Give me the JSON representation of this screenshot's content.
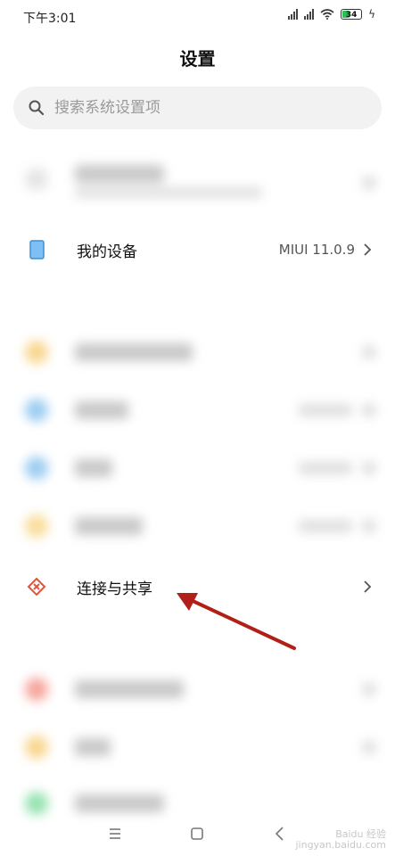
{
  "status_bar": {
    "time": "下午3:01",
    "battery": "34"
  },
  "page": {
    "title": "设置"
  },
  "search": {
    "placeholder": "搜索系统设置项"
  },
  "my_device": {
    "label": "我的设备",
    "value": "MIUI 11.0.9"
  },
  "connection_sharing": {
    "label": "连接与共享"
  },
  "colors": {
    "device_icon": "#5ba8ea",
    "share_icon": "#e2533d",
    "arrow": "#b21f18",
    "blur_orange": "#f5b432",
    "blur_blue": "#4aa3e6",
    "blur_red": "#ef5a4b",
    "blur_green": "#3ecb6f"
  },
  "icons": {
    "search": "search-icon",
    "device": "phone-device-icon",
    "share": "share-connection-icon",
    "chevron": "chevron-right-icon"
  },
  "watermark": {
    "line1": "Baidu 经验",
    "line2": "jingyan.baidu.com"
  }
}
